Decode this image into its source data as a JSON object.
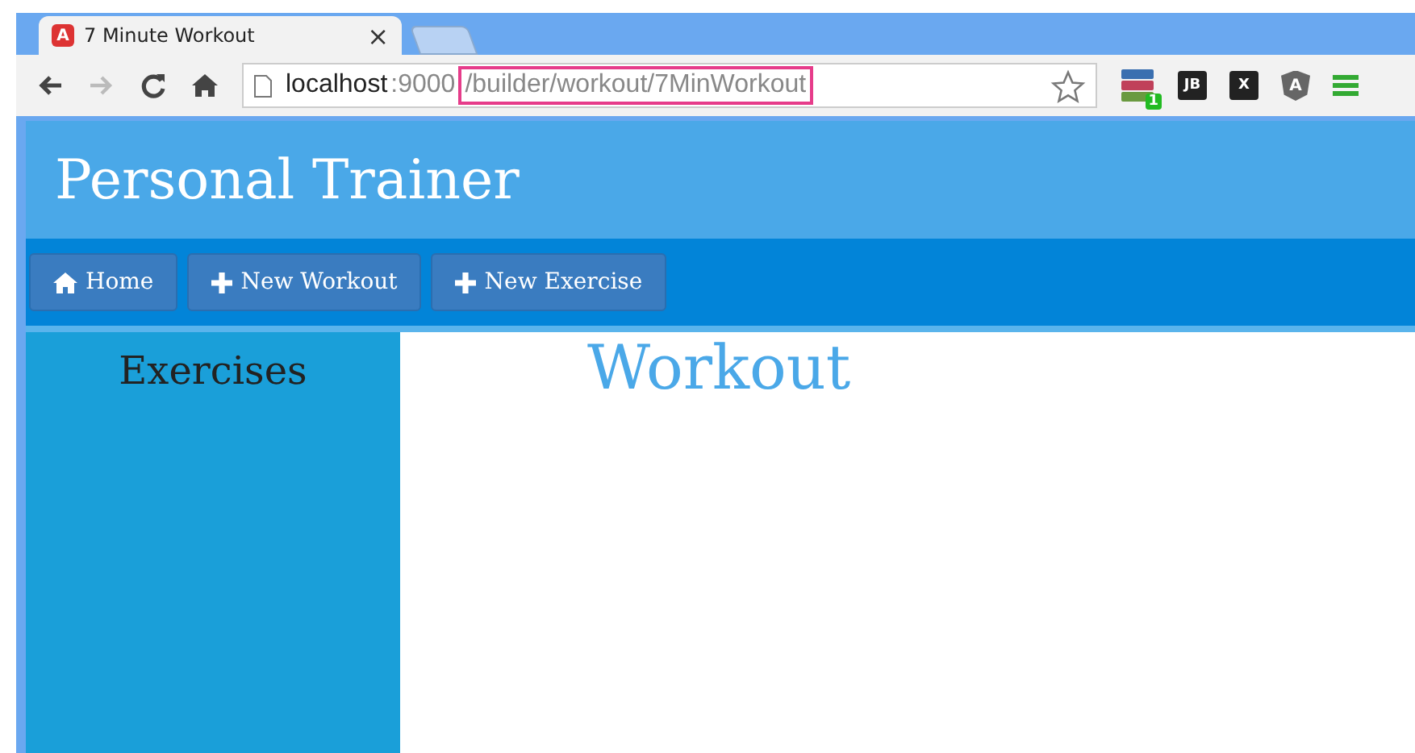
{
  "browser": {
    "tab": {
      "favicon_letter": "A",
      "title": "7 Minute Workout",
      "close": "×"
    },
    "address": {
      "host": "localhost",
      "port": ":9000",
      "path": "/builder/workout/7MinWorkout",
      "path_highlighted": true
    },
    "extensions": [
      {
        "kind": "stack",
        "label": "1"
      },
      {
        "kind": "dark",
        "label": "JB"
      },
      {
        "kind": "dark",
        "label": "X"
      },
      {
        "kind": "shield",
        "label": "A"
      },
      {
        "kind": "menu"
      }
    ]
  },
  "app": {
    "title": "Personal Trainer",
    "nav": [
      {
        "kind": "home",
        "label": "Home"
      },
      {
        "kind": "add",
        "label": "New Workout"
      },
      {
        "kind": "add",
        "label": "New Exercise"
      }
    ],
    "sidebar": {
      "heading": "Exercises"
    },
    "main": {
      "heading": "Workout"
    }
  }
}
